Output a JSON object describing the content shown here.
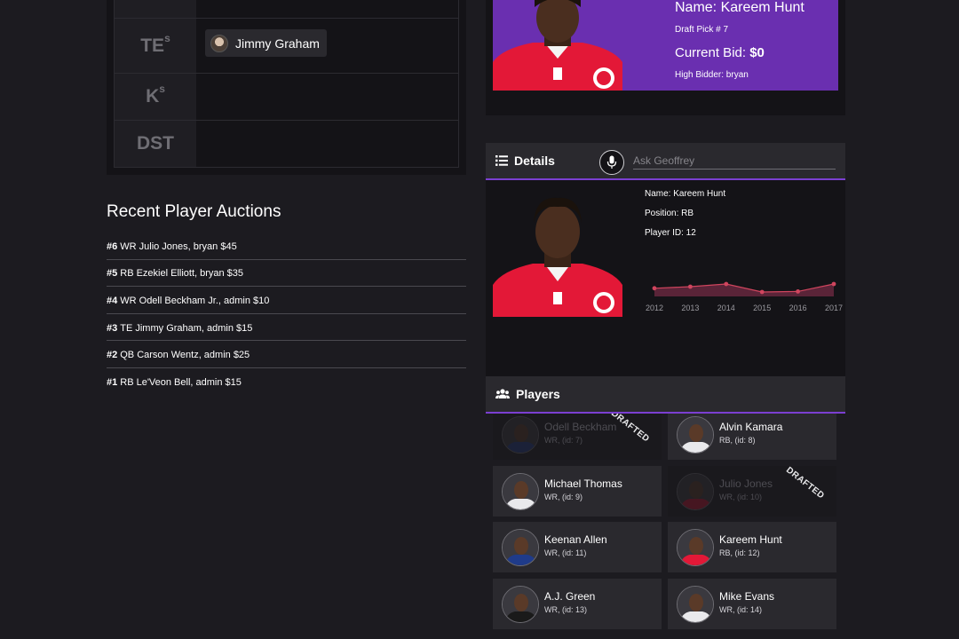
{
  "roster": {
    "rows": [
      {
        "label": "TE",
        "sup": "s",
        "player": "Jimmy Graham"
      },
      {
        "label": "K",
        "sup": "s",
        "player": ""
      },
      {
        "label": "DST",
        "sup": "",
        "player": ""
      }
    ]
  },
  "recent": {
    "title": "Recent Player Auctions",
    "items": [
      {
        "num": "#6",
        "text": "WR Julio Jones, bryan $45"
      },
      {
        "num": "#5",
        "text": "RB Ezekiel Elliott, bryan $35"
      },
      {
        "num": "#4",
        "text": "WR Odell Beckham Jr., admin $10"
      },
      {
        "num": "#3",
        "text": "TE Jimmy Graham, admin $15"
      },
      {
        "num": "#2",
        "text": "QB Carson Wentz, admin $25"
      },
      {
        "num": "#1",
        "text": "RB Le'Veon Bell, admin $15"
      }
    ]
  },
  "current": {
    "name": "Name: Kareem Hunt",
    "pick": "Draft Pick # 7",
    "bid_label": "Current Bid: ",
    "bid_amount": "$0",
    "high": "High Bidder: bryan"
  },
  "details": {
    "title": "Details",
    "ask_placeholder": "Ask Geoffrey",
    "name": "Name: Kareem Hunt",
    "position": "Position: RB",
    "player_id": "Player ID: 12"
  },
  "chart_data": {
    "type": "area",
    "x": [
      "2012",
      "2013",
      "2014",
      "2015",
      "2016",
      "2017"
    ],
    "values": [
      0.6,
      0.75,
      1.0,
      0.25,
      0.3,
      1.0
    ],
    "fill": "#5a2438",
    "line": "#d0455e"
  },
  "players": {
    "title": "Players",
    "drafted_label": "DRAFTED",
    "list": [
      {
        "name": "Odell Beckham",
        "info": "WR, (id: 7)",
        "drafted": true,
        "jersey": "#1f3b8a"
      },
      {
        "name": "Alvin Kamara",
        "info": "RB, (id: 8)",
        "drafted": false,
        "jersey": "#e9e9ec"
      },
      {
        "name": "Michael Thomas",
        "info": "WR, (id: 9)",
        "drafted": false,
        "jersey": "#e9e9ec"
      },
      {
        "name": "Julio Jones",
        "info": "WR, (id: 10)",
        "drafted": true,
        "jersey": "#c8102e"
      },
      {
        "name": "Keenan Allen",
        "info": "WR, (id: 11)",
        "drafted": false,
        "jersey": "#1f3b8a"
      },
      {
        "name": "Kareem Hunt",
        "info": "RB, (id: 12)",
        "drafted": false,
        "jersey": "#e31837"
      },
      {
        "name": "A.J. Green",
        "info": "WR, (id: 13)",
        "drafted": false,
        "jersey": "#1a1a1a"
      },
      {
        "name": "Mike Evans",
        "info": "WR, (id: 14)",
        "drafted": false,
        "jersey": "#e9e9ec"
      }
    ]
  }
}
